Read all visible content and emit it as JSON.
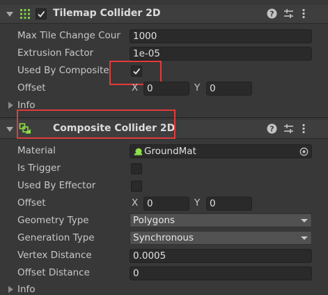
{
  "tilemap_collider": {
    "title": "Tilemap Collider 2D",
    "enabled": true,
    "rows": {
      "max_tile_change_label": "Max Tile Change Cour",
      "max_tile_change_value": "1000",
      "extrusion_label": "Extrusion Factor",
      "extrusion_value": "1e-05",
      "used_by_composite_label": "Used By Composite",
      "used_by_composite_checked": true,
      "offset_label": "Offset",
      "offset_x_axis": "X",
      "offset_x": "0",
      "offset_y_axis": "Y",
      "offset_y": "0",
      "info_label": "Info"
    }
  },
  "composite_collider": {
    "title": "Composite Collider 2D",
    "rows": {
      "material_label": "Material",
      "material_value": "GroundMat",
      "is_trigger_label": "Is Trigger",
      "is_trigger_checked": false,
      "used_by_effector_label": "Used By Effector",
      "used_by_effector_checked": false,
      "offset_label": "Offset",
      "offset_x_axis": "X",
      "offset_x": "0",
      "offset_y_axis": "Y",
      "offset_y": "0",
      "geometry_type_label": "Geometry Type",
      "geometry_type_value": "Polygons",
      "generation_type_label": "Generation Type",
      "generation_type_value": "Synchronous",
      "vertex_distance_label": "Vertex Distance",
      "vertex_distance_value": "0.0005",
      "offset_distance_label": "Offset Distance",
      "offset_distance_value": "0",
      "info_label": "Info"
    }
  },
  "colors": {
    "panel_bg": "#383838",
    "header_bg": "#3e3e3e",
    "field_bg": "#2a2a2a",
    "dropdown_bg": "#515151",
    "highlight": "#e23b3b",
    "tilemap_icon": "#7fd04a",
    "composite_icon": "#8ee04a"
  },
  "icons": [
    "fold-arrow-icon",
    "tilemap-grid-icon",
    "composite-collider-icon",
    "help-icon",
    "presets-icon",
    "more-menu-icon",
    "physics-material-icon",
    "object-picker-icon",
    "checkmark-icon"
  ]
}
